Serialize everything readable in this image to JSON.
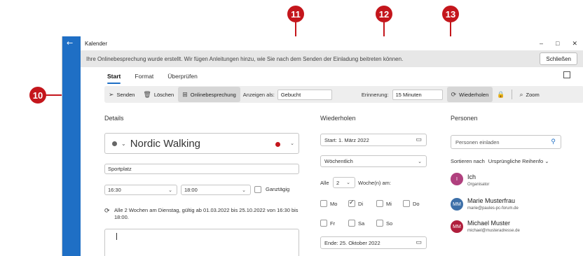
{
  "window": {
    "title": "Kalender",
    "controls": [
      "–",
      "□",
      "✕"
    ]
  },
  "infobar": {
    "message": "Ihre Onlinebesprechung wurde erstellt. Wir fügen Anleitungen hinzu, wie Sie nach dem Senden der Einladung beitreten können.",
    "close_label": "Schließen"
  },
  "tabs": [
    "Start",
    "Format",
    "Überprüfen"
  ],
  "toolbar": {
    "send_label": "Senden",
    "delete_label": "Löschen",
    "online_meeting_label": "Onlinebesprechung",
    "show_as_label": "Anzeigen als:",
    "show_as_value": "Gebucht",
    "reminder_label": "Erinnerung:",
    "reminder_value": "15 Minuten",
    "repeat_label": "Wiederholen",
    "zoom_label": "Zoom"
  },
  "callouts": {
    "c10": "10",
    "c11": "11",
    "c12": "12",
    "c13": "13"
  },
  "details": {
    "section_title": "Details",
    "event_title": "Nordic Walking",
    "location": "Sportplatz",
    "start_time": "16:30",
    "end_time": "18:00",
    "all_day_label": "Ganztägig",
    "recurrence_summary": "Alle 2 Wochen am Dienstag, gültig ab 01.03.2022 bis 25.10.2022 von 16:30 bis 18:00."
  },
  "repeat": {
    "section_title": "Wiederholen",
    "start": "Start: 1. März 2022",
    "frequency": "Wöchentlich",
    "every_label": "Alle",
    "every_value": "2",
    "weeks_label": "Woche(n) am:",
    "days": [
      {
        "label": "Mo",
        "checked": false
      },
      {
        "label": "Di",
        "checked": true
      },
      {
        "label": "Mi",
        "checked": false
      },
      {
        "label": "Do",
        "checked": false
      },
      {
        "label": "Fr",
        "checked": false
      },
      {
        "label": "Sa",
        "checked": false
      },
      {
        "label": "So",
        "checked": false
      }
    ],
    "end": "Ende: 25. Oktober 2022"
  },
  "people": {
    "section_title": "Personen",
    "invite_placeholder": "Personen einladen",
    "sort_label": "Sortieren nach",
    "sort_value": "Ursprüngliche Reihenfo",
    "list": [
      {
        "initials": "I",
        "name": "Ich",
        "sub": "Organisator",
        "color": "#b0407e"
      },
      {
        "initials": "MM",
        "name": "Marie Musterfrau",
        "sub": "marie@paules-pc-forum.de",
        "color": "#3c6fa8"
      },
      {
        "initials": "MM",
        "name": "Michael Muster",
        "sub": "michael@musteradresse.de",
        "color": "#b01e3c"
      }
    ]
  },
  "stray_text": "S",
  "colors": {
    "accent": "#1f6fc5",
    "callout": "#c4161c",
    "category_dot": "#c4161c"
  }
}
